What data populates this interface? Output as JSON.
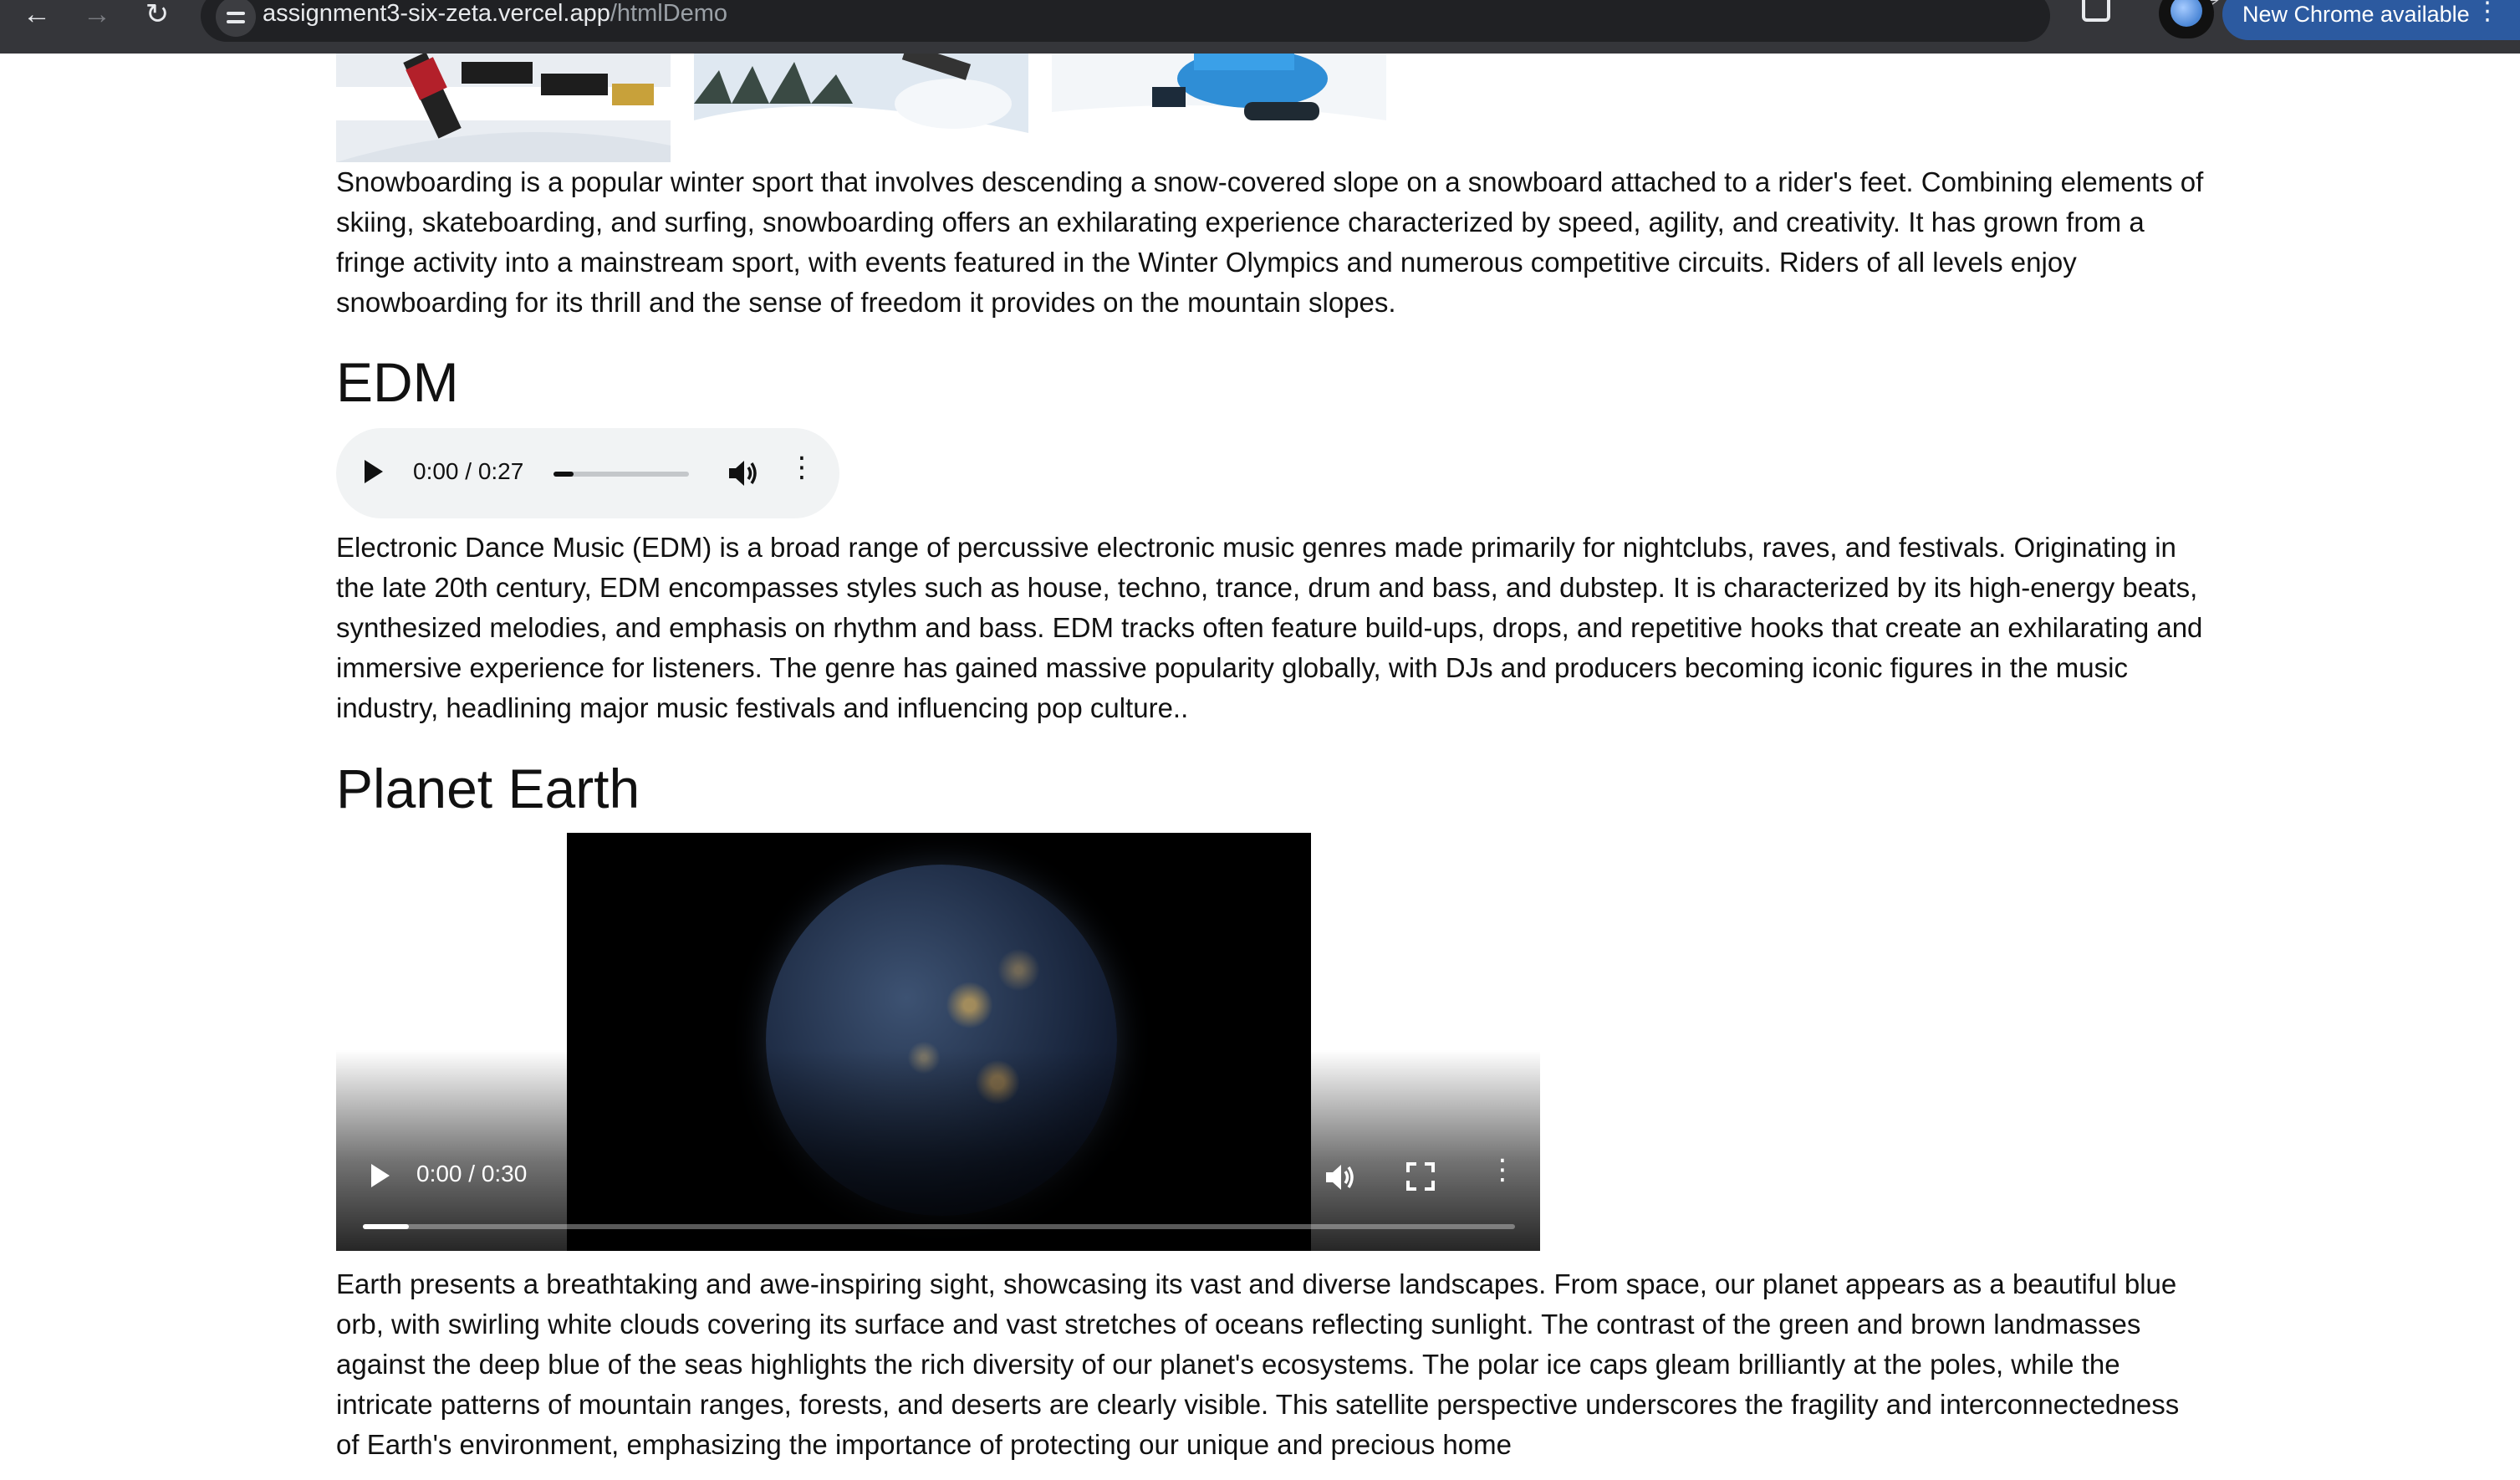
{
  "browser": {
    "url_host": "assignment3-six-zeta.vercel.app",
    "url_path": "/htmlDemo",
    "update_label": "New Chrome available"
  },
  "snowboarding": {
    "images": [
      "snowboard-halfpipe-photo",
      "snowboard-jump-photo",
      "snowboard-carve-photo"
    ],
    "paragraph": "Snowboarding is a popular winter sport that involves descending a snow-covered slope on a snowboard attached to a rider's feet. Combining elements of skiing, skateboarding, and surfing, snowboarding offers an exhilarating experience characterized by speed, agility, and creativity. It has grown from a fringe activity into a mainstream sport, with events featured in the Winter Olympics and numerous competitive circuits. Riders of all levels enjoy snowboarding for its thrill and the sense of freedom it provides on the mountain slopes."
  },
  "edm": {
    "heading": "EDM",
    "audio": {
      "time": "0:00 / 0:27",
      "progress_fraction": 0.15
    },
    "paragraph": "Electronic Dance Music (EDM) is a broad range of percussive electronic music genres made primarily for nightclubs, raves, and festivals. Originating in the late 20th century, EDM encompasses styles such as house, techno, trance, drum and bass, and dubstep. It is characterized by its high-energy beats, synthesized melodies, and emphasis on rhythm and bass. EDM tracks often feature build-ups, drops, and repetitive hooks that create an exhilarating and immersive experience for listeners. The genre has gained massive popularity globally, with DJs and producers becoming iconic figures in the music industry, headlining major music festivals and influencing pop culture.."
  },
  "planet_earth": {
    "heading": "Planet Earth",
    "video": {
      "time": "0:00 / 0:30",
      "progress_fraction": 0.04
    },
    "paragraph": "Earth presents a breathtaking and awe-inspiring sight, showcasing its vast and diverse landscapes. From space, our planet appears as a beautiful blue orb, with swirling white clouds covering its surface and vast stretches of oceans reflecting sunlight. The contrast of the green and brown landmasses against the deep blue of the seas highlights the rich diversity of our planet's ecosystems. The polar ice caps gleam brilliantly at the poles, while the intricate patterns of mountain ranges, forests, and deserts are clearly visible. This satellite perspective underscores the fragility and interconnectedness of Earth's environment, emphasizing the importance of protecting our unique and precious home"
  }
}
